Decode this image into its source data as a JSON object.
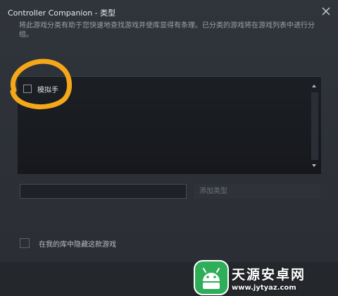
{
  "window": {
    "title": "Controller Companion - 类型"
  },
  "description": "将此游戏分类有助于您快速地查找游戏并使库显得有条理。已分类的游戏将在游戏列表中进行分组。",
  "categories": {
    "items": [
      {
        "label": "模拟手",
        "checked": false
      }
    ]
  },
  "new_category": {
    "value": "",
    "placeholder": "",
    "add_label": "添加类型"
  },
  "hide_game": {
    "label": "在我的库中隐藏这款游戏",
    "checked": false
  },
  "annotation": {
    "color": "#f5a71a"
  },
  "watermark": {
    "title": "天源安卓网",
    "url": "www.jytyaz.com",
    "brand_color": "#2fae5a"
  }
}
